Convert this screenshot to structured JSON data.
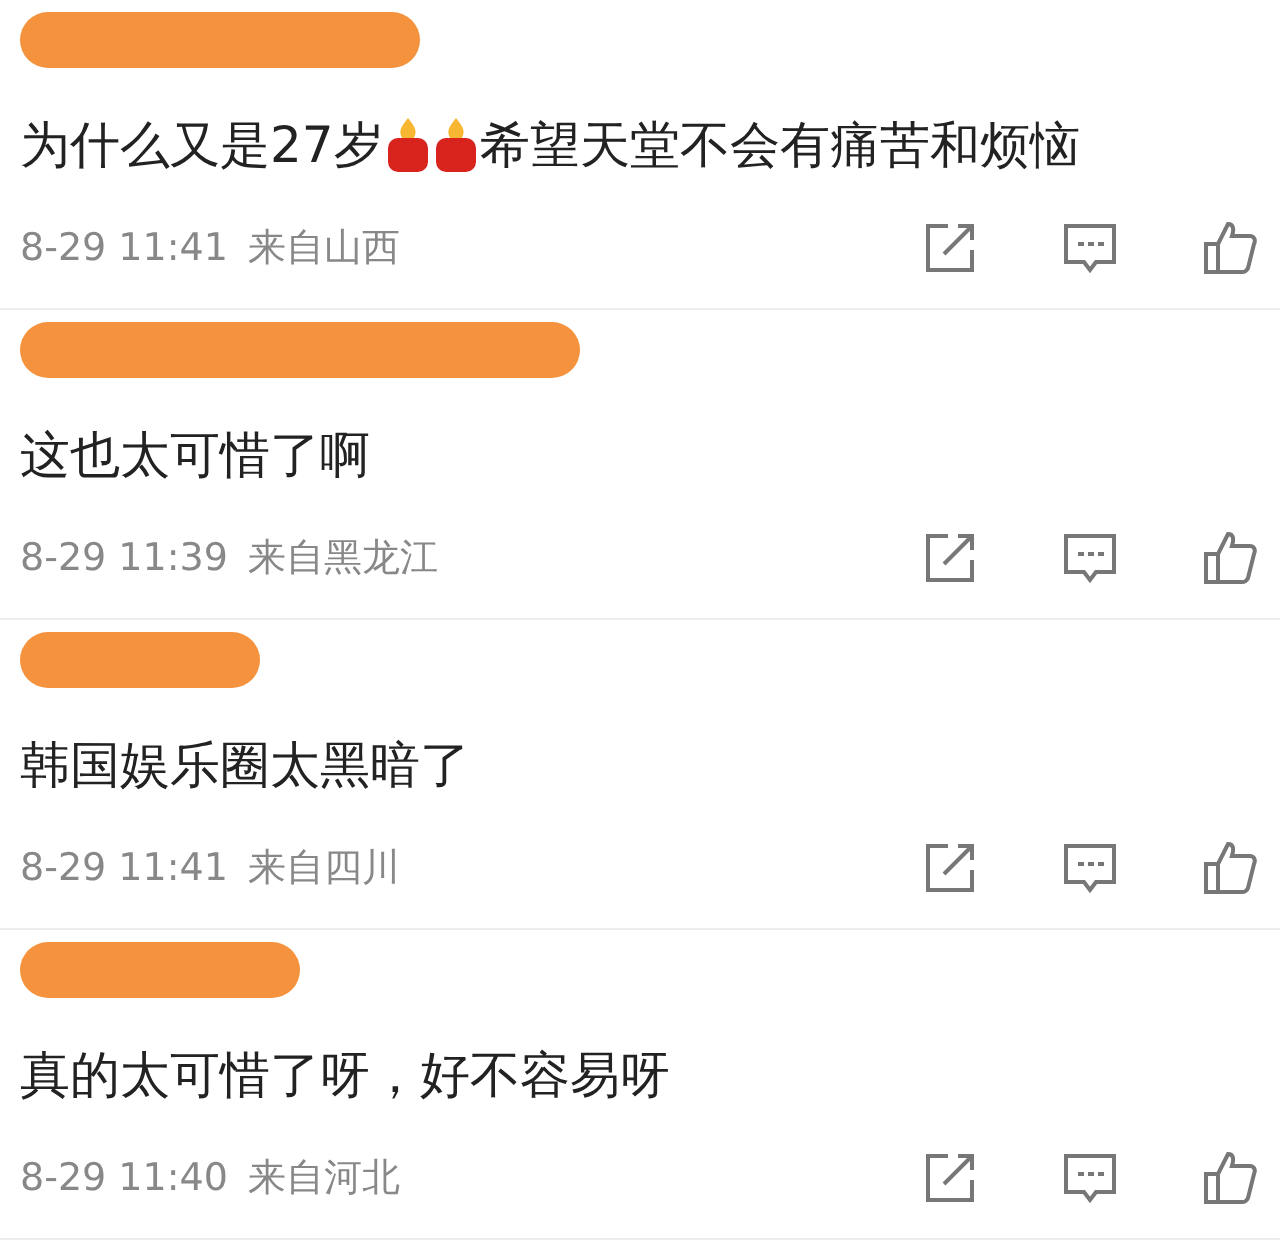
{
  "comments": [
    {
      "segments": [
        {
          "kind": "text",
          "text": "为什么又是27岁"
        },
        {
          "kind": "candle"
        },
        {
          "kind": "candle"
        },
        {
          "kind": "text",
          "text": "希望天堂不会有痛苦和烦恼"
        }
      ],
      "time": "8-29 11:41",
      "location": "来自山西"
    },
    {
      "segments": [
        {
          "kind": "text",
          "text": "这也太可惜了啊"
        }
      ],
      "time": "8-29 11:39",
      "location": "来自黑龙江"
    },
    {
      "segments": [
        {
          "kind": "text",
          "text": "韩国娱乐圈太黑暗了"
        }
      ],
      "time": "8-29 11:41",
      "location": "来自四川"
    },
    {
      "segments": [
        {
          "kind": "text",
          "text": "真的太可惜了呀，好不容易呀"
        }
      ],
      "time": "8-29 11:40",
      "location": "来自河北"
    }
  ]
}
